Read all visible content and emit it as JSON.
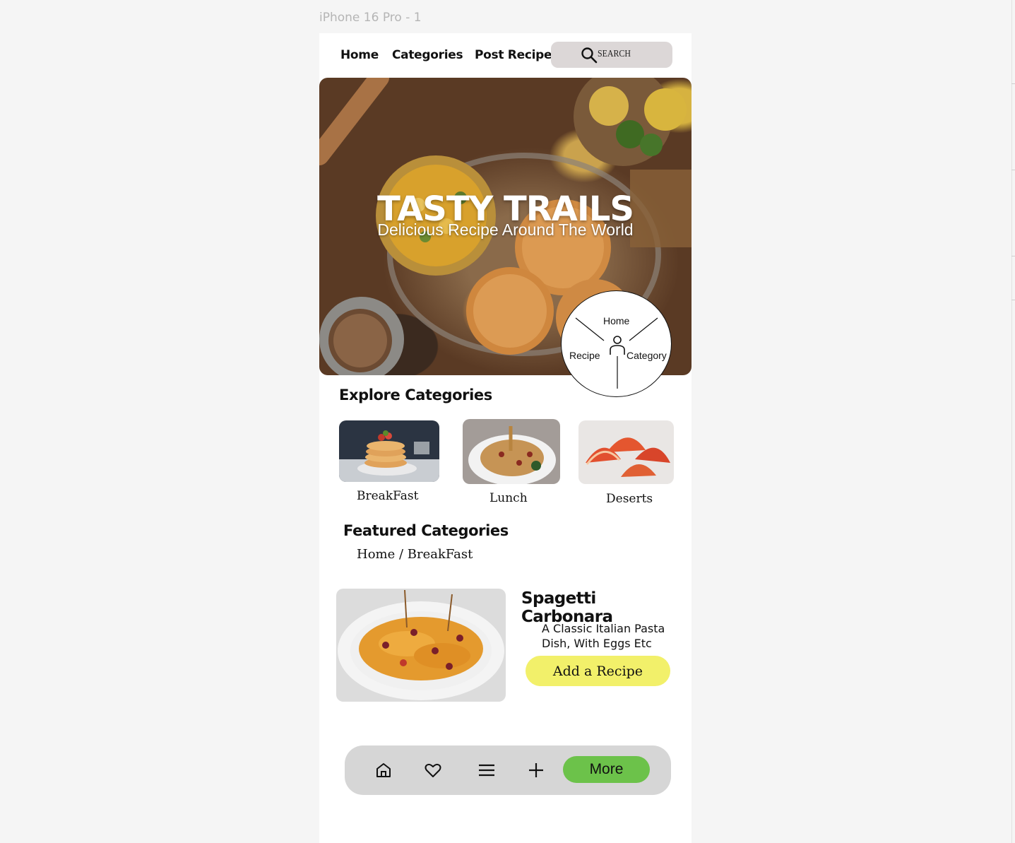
{
  "frame": {
    "label": "iPhone 16 Pro - 1"
  },
  "nav": {
    "items": [
      "Home",
      "Categories",
      "Post Recipe"
    ],
    "search_label": "SEARCH"
  },
  "hero": {
    "title": "TASTY TRAILS",
    "subtitle": "Delicious Recipe Around The World"
  },
  "radial_menu": {
    "top": "Home",
    "left": "Recipe",
    "right": "Category"
  },
  "explore": {
    "title": "Explore Categories",
    "categories": [
      "BreakFast",
      "Lunch",
      "Deserts"
    ]
  },
  "featured": {
    "title": "Featured Categories",
    "breadcrumb": "Home / BreakFast",
    "recipe_title": "Spagetti Carbonara",
    "recipe_desc": "A Classic Italian Pasta Dish, With Eggs Etc",
    "add_button": "Add a Recipe"
  },
  "bottom_bar": {
    "icons": [
      "home-icon",
      "heart-icon",
      "menu-icon",
      "plus-icon"
    ],
    "more_label": "More"
  },
  "colors": {
    "search_bg": "#dcd7d7",
    "add_button": "#f2f06a",
    "more_button": "#6cc24a",
    "bottom_bar": "#d6d6d6"
  }
}
